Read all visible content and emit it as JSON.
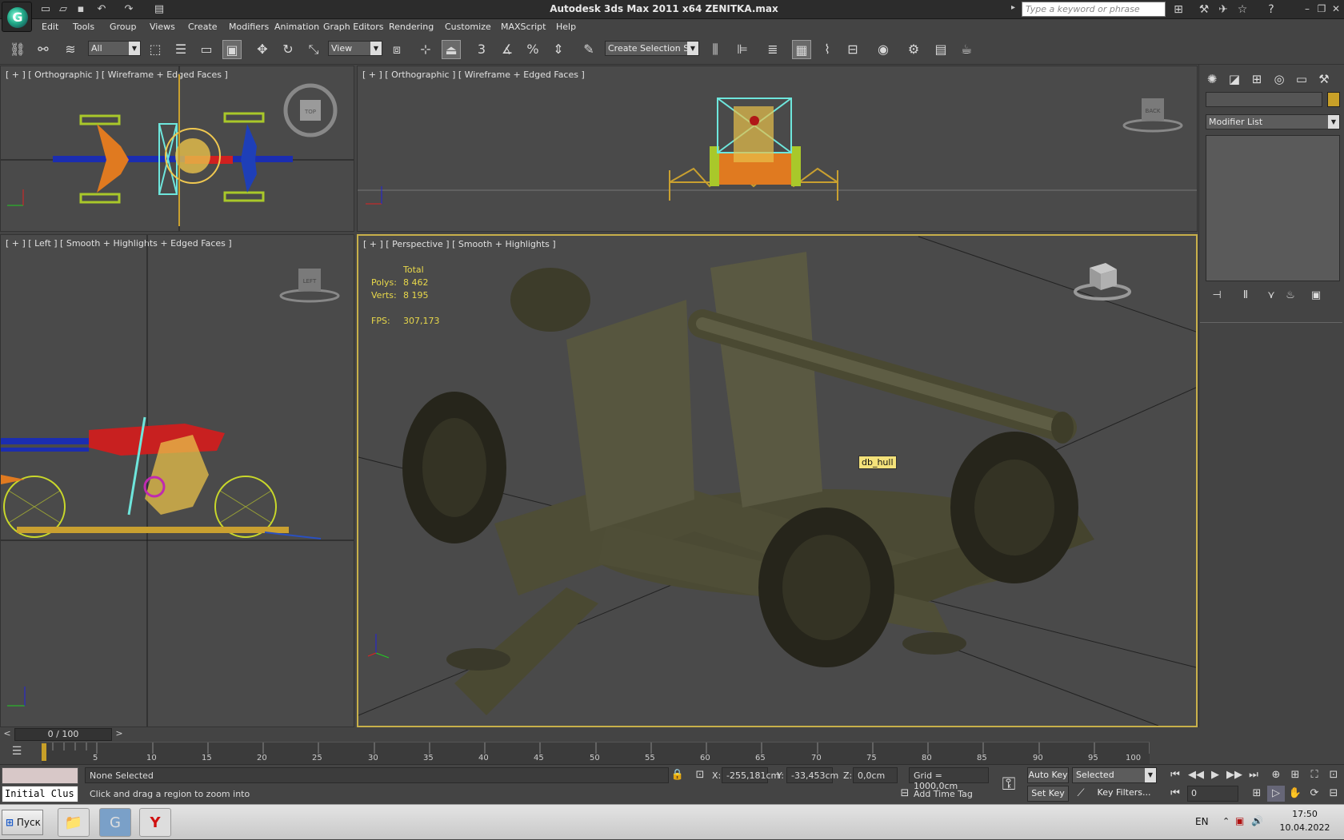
{
  "title_bar": {
    "title": "Autodesk 3ds Max  2011 x64      ZENITKA.max",
    "search_placeholder": "Type a keyword or phrase"
  },
  "menu": [
    "Edit",
    "Tools",
    "Group",
    "Views",
    "Create",
    "Modifiers",
    "Animation",
    "Graph Editors",
    "Rendering",
    "Customize",
    "MAXScript",
    "Help"
  ],
  "toolbar": {
    "selection_filter": "All",
    "ref_coord": "View",
    "named_selection_placeholder": "Create Selection Se"
  },
  "viewports": {
    "top_left": {
      "label": "[ + ] [ Orthographic ] [ Wireframe + Edged Faces ]",
      "cube_label": "TOP"
    },
    "top_right": {
      "label": "[ + ] [ Orthographic ] [ Wireframe + Edged Faces ]",
      "cube_label": "BACK"
    },
    "bottom_left": {
      "label": "[ + ] [ Left ] [ Smooth + Highlights + Edged Faces ]",
      "cube_label": "LEFT"
    },
    "perspective": {
      "label": "[ + ] [ Perspective ] [ Smooth + Highlights ]",
      "stats": {
        "header": "Total",
        "polys_label": "Polys:",
        "polys_value": "8 462",
        "verts_label": "Verts:",
        "verts_value": "8 195",
        "fps_label": "FPS:",
        "fps_value": "307,173"
      },
      "tooltip": "db_hull"
    }
  },
  "command_panel": {
    "modifier_list": "Modifier List"
  },
  "timeline": {
    "frame_display": "0 / 100",
    "ticks": [
      "5",
      "10",
      "15",
      "20",
      "25",
      "30",
      "35",
      "40",
      "45",
      "50",
      "55",
      "60",
      "65",
      "70",
      "75",
      "80",
      "85",
      "90",
      "95",
      "100"
    ]
  },
  "status": {
    "script_listener": "Initial Clus",
    "selection_status": "None Selected",
    "prompt": "Click and drag a region to zoom into",
    "x_label": "X:",
    "x_value": "-255,181cm",
    "y_label": "Y:",
    "y_value": "-33,453cm",
    "z_label": "Z:",
    "z_value": "0,0cm",
    "grid": "Grid = 1000,0cm",
    "add_time_tag": "Add Time Tag",
    "auto_key": "Auto Key",
    "set_key": "Set Key",
    "key_mode": "Selected",
    "key_filters": "Key Filters...",
    "current_frame": "0"
  },
  "taskbar": {
    "start": "Пуск",
    "lang": "EN",
    "time": "17:50",
    "date": "10.04.2022"
  }
}
